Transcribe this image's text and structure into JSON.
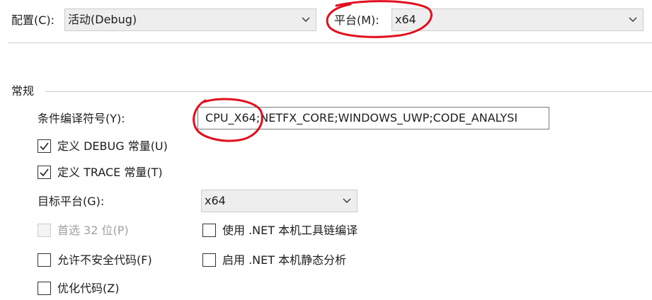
{
  "config": {
    "label": "配置(C):",
    "value": "活动(Debug)"
  },
  "platform": {
    "label": "平台(M):",
    "value": "x64"
  },
  "general": {
    "section_title": "常规",
    "conditional_symbols": {
      "label": "条件编译符号(Y):",
      "value": "CPU_X64;NETFX_CORE;WINDOWS_UWP;CODE_ANALYSI"
    },
    "define_debug": {
      "label": "定义 DEBUG 常量(U)",
      "checked": true
    },
    "define_trace": {
      "label": "定义 TRACE 常量(T)",
      "checked": true
    },
    "target_platform": {
      "label": "目标平台(G):",
      "value": "x64"
    },
    "prefer32": {
      "label": "首选 32 位(P)",
      "checked": false,
      "enabled": false
    },
    "allow_unsafe": {
      "label": "允许不安全代码(F)",
      "checked": false
    },
    "optimize": {
      "label": "优化代码(Z)",
      "checked": false
    },
    "net_native": {
      "label": "使用 .NET 本机工具链编译",
      "checked": false
    },
    "static_analysis": {
      "label": "启用 .NET 本机静态分析",
      "checked": false
    }
  },
  "colors": {
    "annotation": "#e0101e",
    "border": "#cccccc",
    "combo_bg": "#eeeeee"
  }
}
